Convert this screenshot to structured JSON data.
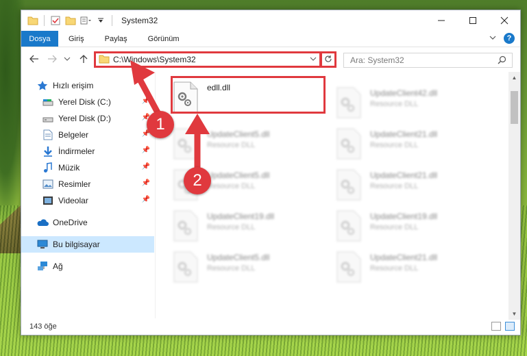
{
  "window": {
    "title": "System32",
    "controls": [
      "—",
      "☐",
      "✕"
    ]
  },
  "ribbon": {
    "file_tab": "Dosya",
    "tabs": [
      "Giriş",
      "Paylaş",
      "Görünüm"
    ]
  },
  "navbar": {
    "address_path": "C:\\Windows\\System32",
    "search_placeholder": "Ara: System32"
  },
  "sidebar": {
    "quick_access": "Hızlı erişim",
    "pinned": [
      {
        "label": "Yerel Disk (C:)",
        "icon": "drive-icon"
      },
      {
        "label": "Yerel Disk (D:)",
        "icon": "drive-icon"
      },
      {
        "label": "Belgeler",
        "icon": "documents-icon"
      },
      {
        "label": "İndirmeler",
        "icon": "downloads-icon"
      },
      {
        "label": "Müzik",
        "icon": "music-icon"
      },
      {
        "label": "Resimler",
        "icon": "pictures-icon"
      },
      {
        "label": "Videolar",
        "icon": "videos-icon"
      }
    ],
    "onedrive": "OneDrive",
    "this_pc": "Bu bilgisayar",
    "network": "Ağ"
  },
  "files": [
    {
      "name": "edll.dll",
      "type": "",
      "focused": true
    },
    {
      "name": "UpdateClient42.dll",
      "type": "Resource DLL"
    },
    {
      "name": "UpdateClient5.dll",
      "type": "Resource DLL"
    },
    {
      "name": "UpdateClient21.dll",
      "type": "Resource DLL"
    },
    {
      "name": "UpdateClient5.dll",
      "type": "Resource DLL"
    },
    {
      "name": "UpdateClient21.dll",
      "type": "Resource DLL"
    },
    {
      "name": "UpdateClient19.dll",
      "type": "Resource DLL"
    },
    {
      "name": "UpdateClient19.dll",
      "type": "Resource DLL"
    },
    {
      "name": "UpdateClient5.dll",
      "type": "Resource DLL"
    },
    {
      "name": "UpdateClient21.dll",
      "type": "Resource DLL"
    }
  ],
  "status": {
    "item_count": "143 öğe"
  },
  "annotations": {
    "step1": "1",
    "step2": "2"
  },
  "colors": {
    "accent": "#1979ca",
    "highlight_red": "#e0393e",
    "selected_bg": "#cce8ff"
  }
}
